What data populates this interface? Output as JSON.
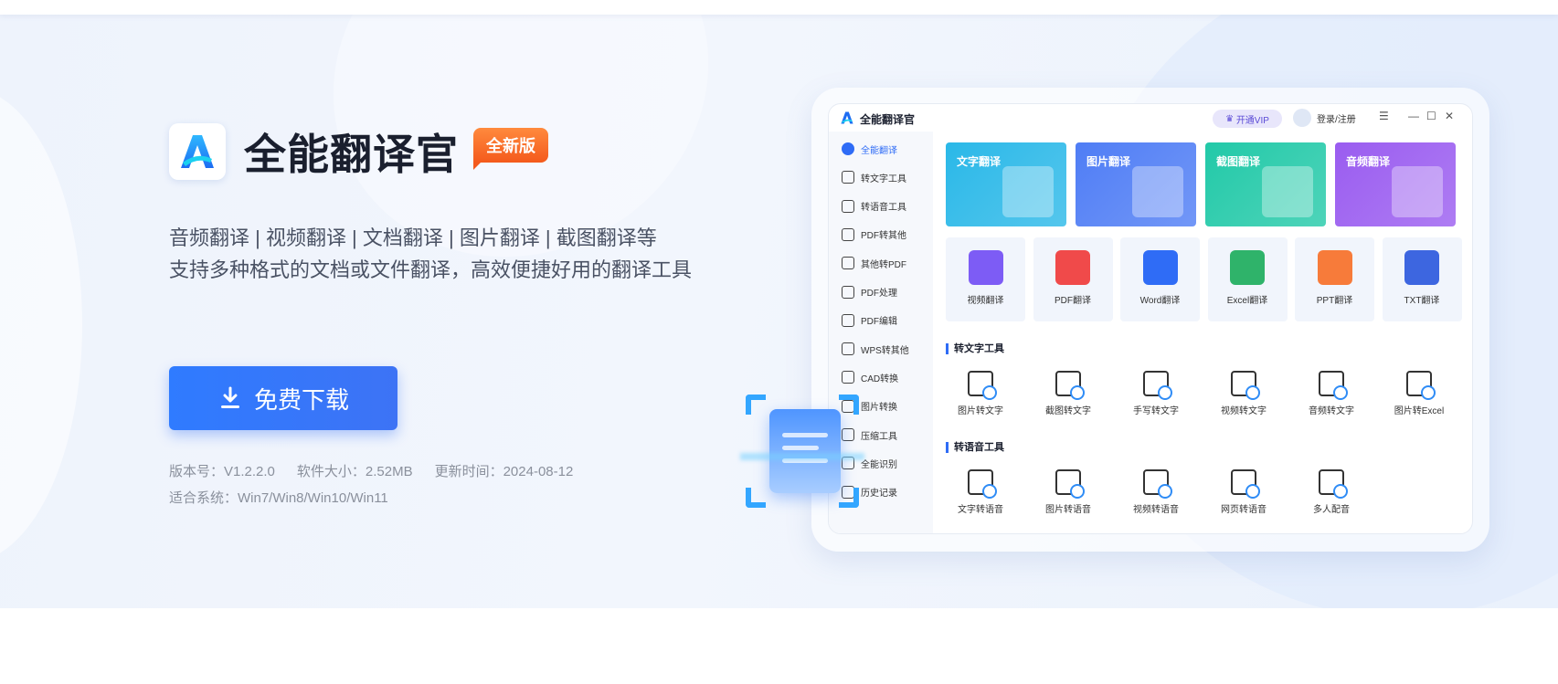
{
  "hero": {
    "app_name": "全能翻译官",
    "badge": "全新版",
    "tagline_line1": "音频翻译 | 视频翻译 | 文档翻译 | 图片翻译 | 截图翻译等",
    "tagline_line2": "支持多种格式的文档或文件翻译，高效便捷好用的翻译工具",
    "download_label": "免费下载",
    "version": "版本号：V1.2.2.0",
    "size": "软件大小：2.52MB",
    "updated": "更新时间：2024-08-12",
    "systems": "适合系统：Win7/Win8/Win10/Win11",
    "accent_color": "#2f7bff",
    "badge_color": "#f45a1c"
  },
  "mockup": {
    "title": "全能翻译官",
    "vip_label": "开通VIP",
    "login_label": "登录/注册",
    "controls": [
      "☰",
      "—",
      "☐",
      "✕"
    ],
    "sidebar": [
      {
        "label": "全能翻译",
        "icon": "translate-icon",
        "active": true
      },
      {
        "label": "转文字工具",
        "icon": "text-icon"
      },
      {
        "label": "转语音工具",
        "icon": "voice-icon"
      },
      {
        "label": "PDF转其他",
        "icon": "pdf-icon"
      },
      {
        "label": "其他转PDF",
        "icon": "pdf-convert-icon"
      },
      {
        "label": "PDF处理",
        "icon": "pdf-process-icon"
      },
      {
        "label": "PDF编辑",
        "icon": "pdf-edit-icon"
      },
      {
        "label": "WPS转其他",
        "icon": "wps-icon"
      },
      {
        "label": "CAD转换",
        "icon": "cad-icon"
      },
      {
        "label": "图片转换",
        "icon": "image-icon"
      },
      {
        "label": "压缩工具",
        "icon": "compress-icon"
      },
      {
        "label": "全能识别",
        "icon": "scan-icon"
      },
      {
        "label": "历史记录",
        "icon": "history-icon"
      }
    ],
    "big_cards": [
      {
        "label": "文字翻译",
        "color": "#2ab8e8"
      },
      {
        "label": "图片翻译",
        "color": "#4f7df5"
      },
      {
        "label": "截图翻译",
        "color": "#22c9a8"
      },
      {
        "label": "音频翻译",
        "color": "#9a5cf0"
      }
    ],
    "small_cards": [
      {
        "label": "视频翻译",
        "color": "#7d5cf5"
      },
      {
        "label": "PDF翻译",
        "color": "#f04a4a"
      },
      {
        "label": "Word翻译",
        "color": "#2f6cf6"
      },
      {
        "label": "Excel翻译",
        "color": "#2fb36a"
      },
      {
        "label": "PPT翻译",
        "color": "#f77b3a"
      },
      {
        "label": "TXT翻译",
        "color": "#3d66e0"
      }
    ],
    "section_text": "转文字工具",
    "text_tools": [
      "图片转文字",
      "截图转文字",
      "手写转文字",
      "视频转文字",
      "音频转文字",
      "图片转Excel"
    ],
    "section_voice": "转语音工具",
    "voice_tools": [
      "文字转语音",
      "图片转语音",
      "视频转语音",
      "网页转语音",
      "多人配音"
    ]
  }
}
